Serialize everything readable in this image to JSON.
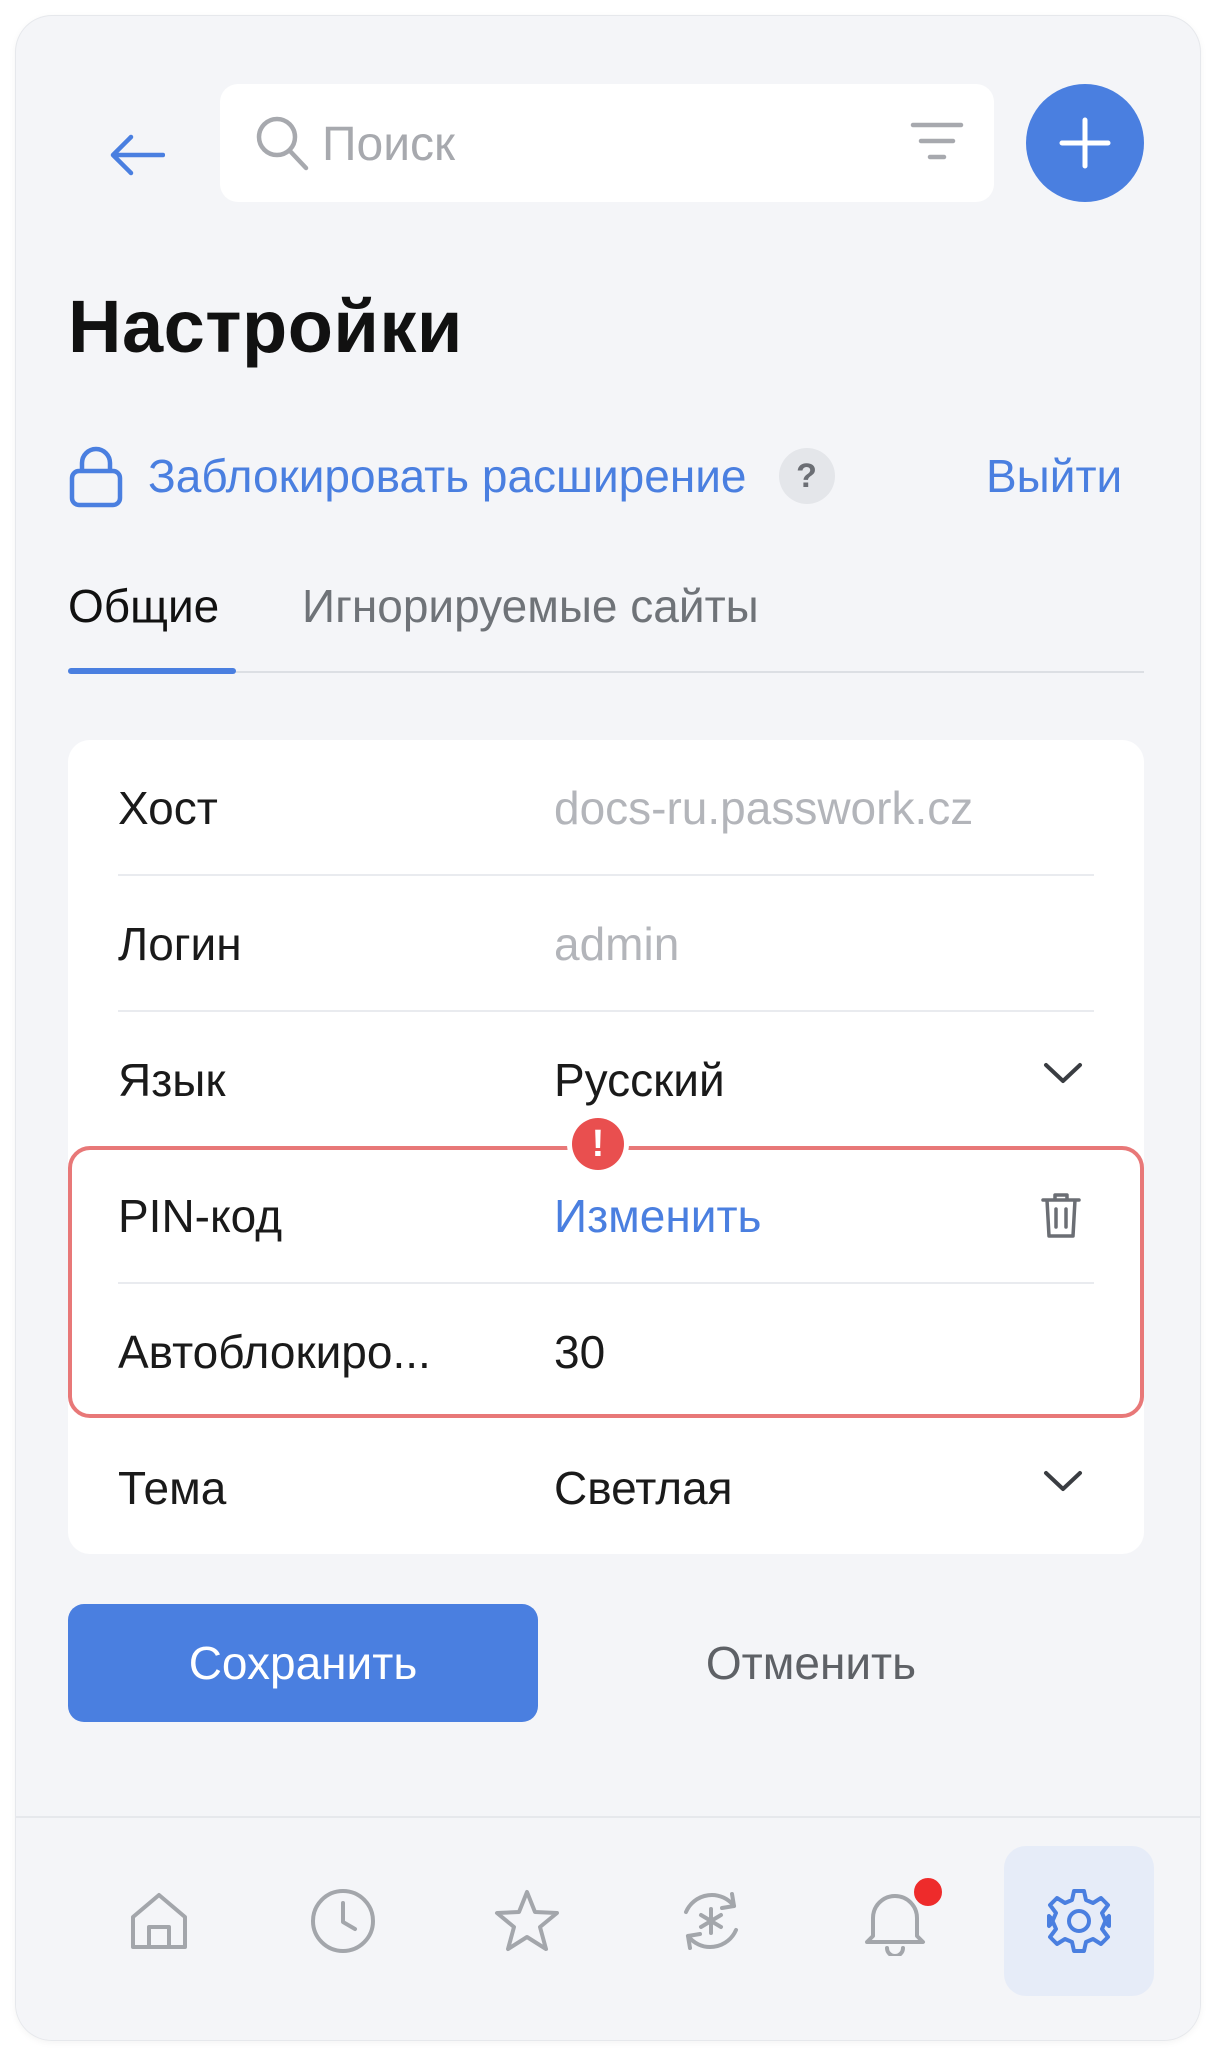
{
  "header": {
    "search_placeholder": "Поиск",
    "accent_color": "#4a7fe0"
  },
  "page": {
    "title": "Настройки"
  },
  "lock": {
    "label": "Заблокировать расширение",
    "help": "?",
    "logout": "Выйти"
  },
  "tabs": [
    {
      "label": "Общие",
      "active": true
    },
    {
      "label": "Игнорируемые сайты",
      "active": false
    }
  ],
  "settings": {
    "host": {
      "label": "Хост",
      "value": "docs-ru.passwork.cz"
    },
    "login": {
      "label": "Логин",
      "value": "admin"
    },
    "language": {
      "label": "Язык",
      "value": "Русский"
    },
    "pin": {
      "label": "PIN-код",
      "value": "Изменить"
    },
    "autolock": {
      "label": "Автоблокиро...",
      "value": "30"
    },
    "theme": {
      "label": "Тема",
      "value": "Светлая"
    }
  },
  "warning": {
    "symbol": "!",
    "color": "#e94f4f",
    "outline_color": "#e87878"
  },
  "actions": {
    "save": "Сохранить",
    "cancel": "Отменить"
  },
  "bottom_nav": {
    "items": [
      {
        "icon": "home-icon",
        "active": false
      },
      {
        "icon": "clock-icon",
        "active": false
      },
      {
        "icon": "star-icon",
        "active": false
      },
      {
        "icon": "password-generator-icon",
        "active": false
      },
      {
        "icon": "bell-icon",
        "active": false,
        "has_notification": true
      },
      {
        "icon": "gear-icon",
        "active": true
      }
    ]
  }
}
